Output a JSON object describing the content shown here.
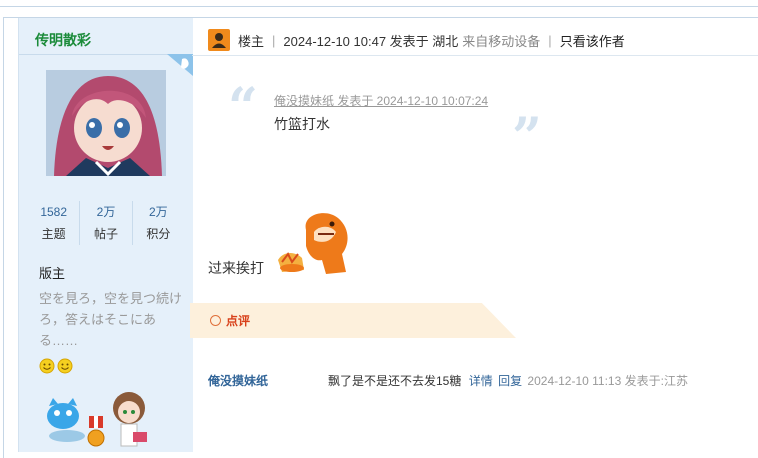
{
  "sidebar": {
    "author": "传明散彩",
    "stats": [
      {
        "value": "1582",
        "label": "主题"
      },
      {
        "value": "2万",
        "label": "帖子"
      },
      {
        "value": "2万",
        "label": "积分"
      }
    ],
    "rank": "版主",
    "signature": "空を見ろ，空を見つ続けろ，答えはそこにある……"
  },
  "header": {
    "floor": "楼主",
    "posted": "2024-12-10 10:47 发表于 湖北",
    "device": "来自移动设备",
    "only_author": "只看该作者"
  },
  "quote": {
    "meta": "俺没摸妹纸 发表于 2024-12-10 10:07:24",
    "body": "竹篮打水"
  },
  "post": {
    "text": "过来挨打"
  },
  "comments": {
    "title": "点评",
    "items": [
      {
        "author": "俺没摸妹纸",
        "body": "飘了是不是还不去发15糖",
        "detail": "详情",
        "reply": "回复",
        "meta": "2024-12-10 11:13 发表于:江苏"
      }
    ]
  },
  "colors": {
    "sidebar_bg": "#e5f0fa",
    "author_green": "#1b8b3a",
    "link_blue": "#336699",
    "comment_red": "#d8401a",
    "banner_bg": "#fdf0dc"
  },
  "icons": [
    "floor-owner-icon",
    "smile-icon",
    "ring-icon",
    "corner-badge-icon"
  ]
}
